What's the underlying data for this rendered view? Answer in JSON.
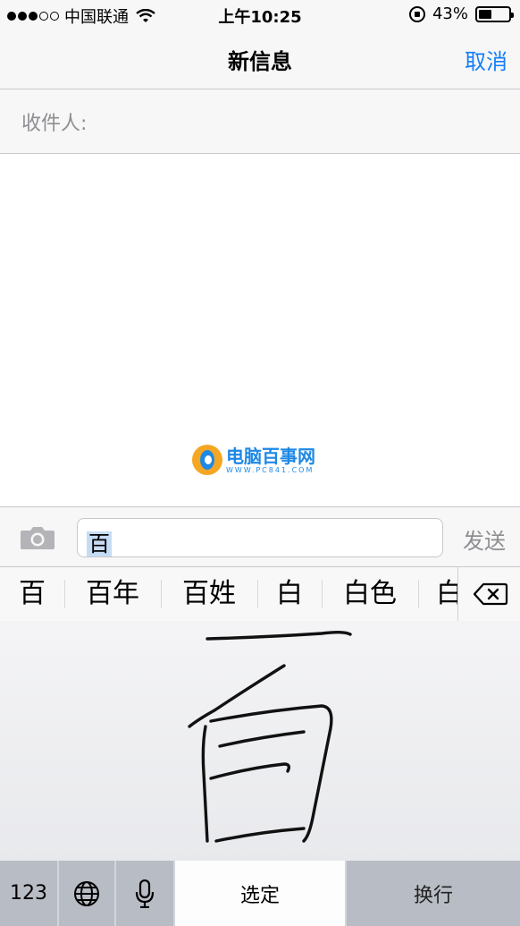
{
  "status_bar": {
    "carrier": "中国联通",
    "time": "上午10:25",
    "battery_text": "43%",
    "battery_level": 0.43
  },
  "nav": {
    "title": "新信息",
    "cancel_label": "取消"
  },
  "recipient": {
    "label": "收件人:"
  },
  "watermark": {
    "name": "电脑百事网",
    "url": "WWW.PC841.COM"
  },
  "compose": {
    "input_value": "百",
    "send_label": "发送"
  },
  "candidates": [
    "百",
    "百年",
    "百姓",
    "白",
    "白色",
    "白"
  ],
  "keys": {
    "numbers_label": "123",
    "confirm_label": "选定",
    "return_label": "换行"
  },
  "colors": {
    "accent": "#147efb",
    "inactive": "#8e8e93"
  }
}
